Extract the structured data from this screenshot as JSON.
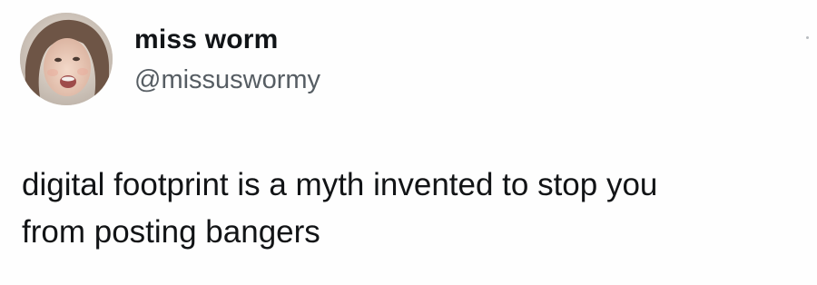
{
  "author": {
    "display_name": "miss worm",
    "handle": "@missuswormy",
    "avatar_icon": "profile-photo-avatar"
  },
  "tweet": {
    "text_lines": [
      "digital footprint is a myth invented to stop you",
      "from posting bangers"
    ]
  },
  "menu": {
    "icon": "more-options-icon"
  },
  "colors": {
    "background": "#fefefe",
    "name_text": "#111417",
    "handle_text": "#565d63",
    "body_text": "#121416"
  }
}
